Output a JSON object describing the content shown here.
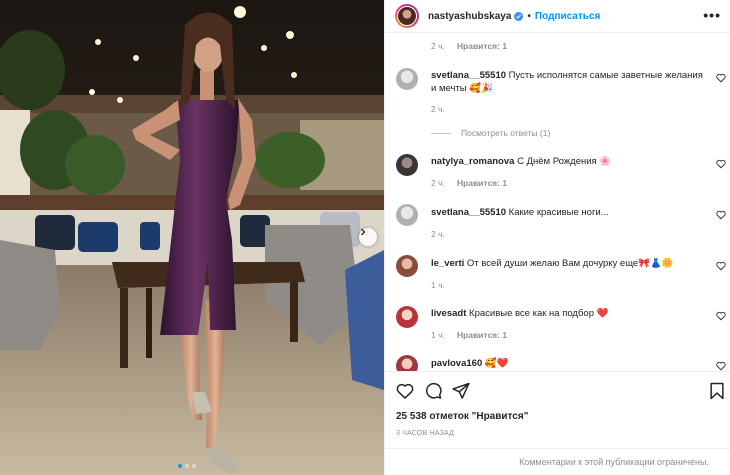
{
  "header": {
    "username": "nastyashubskaya",
    "separator": "•",
    "follow_label": "Подписаться",
    "more_label": "•••"
  },
  "comments": [
    {
      "meta_time": "2 ч.",
      "meta_likes": "Нравится: 1"
    },
    {
      "username": "svetlana__55510",
      "text": "Пусть исполнятся самые заветные желания и мечты 🥰🎉",
      "meta_time": "2 ч."
    },
    {
      "view_replies": "Посмотреть ответы (1)"
    },
    {
      "username": "natylya_romanova",
      "text": "С Днём Рождения 🌸",
      "meta_time": "2 ч.",
      "meta_likes": "Нравится: 1"
    },
    {
      "username": "svetlana__55510",
      "text": "Какие красивые ноги...",
      "meta_time": "2 ч."
    },
    {
      "username": "le_verti",
      "text": "От всей души желаю Вам дочурку еще🎀👗🌼",
      "meta_time": "1 ч."
    },
    {
      "username": "livesadt",
      "text": "Красивые все как на подбор ❤️",
      "meta_time": "1 ч.",
      "meta_likes": "Нравится: 1"
    },
    {
      "username": "pavlova160",
      "text": "🥰❤️"
    }
  ],
  "likes_count": "25 538 отметок \"Нравится\"",
  "time_ago": "3 ЧАСОВ НАЗАД",
  "comments_limited": "Комментарии к этой публикации ограничены.",
  "colors": {
    "accent": "#0095f6",
    "muted": "#8e8e8e",
    "dress": "#4a2346",
    "carousel_active": "#1b95e0"
  },
  "icons": [
    "verified-badge-icon",
    "more-options-icon",
    "heart-icon",
    "comment-icon",
    "share-icon",
    "bookmark-icon",
    "chevron-right-icon"
  ]
}
